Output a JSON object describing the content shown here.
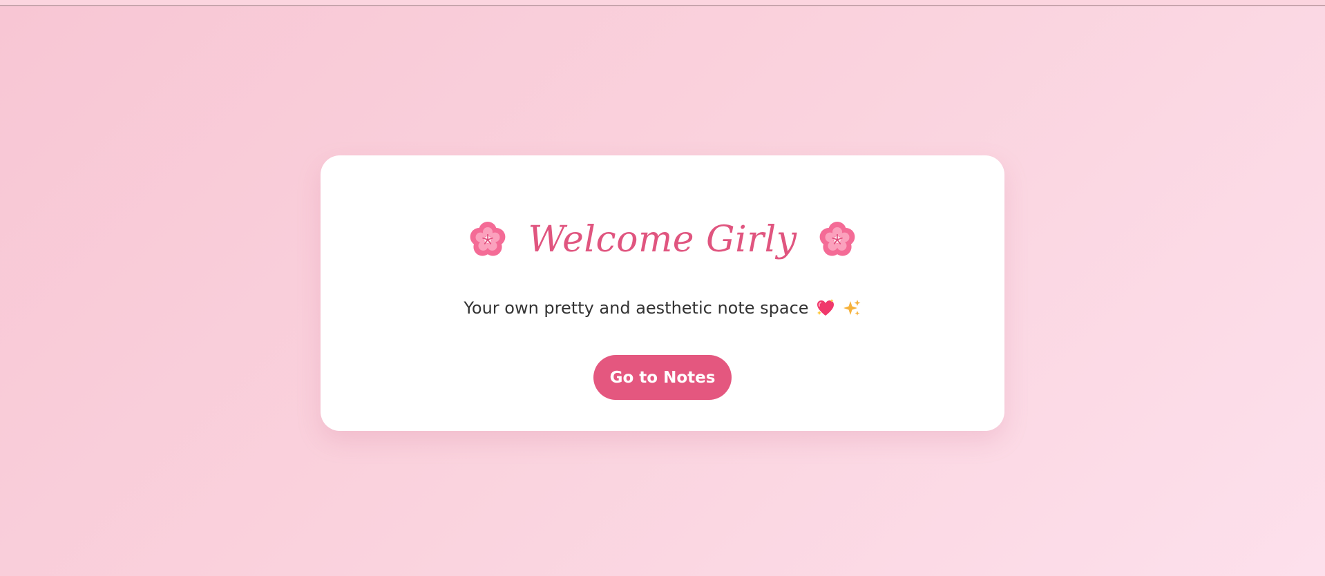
{
  "welcome": {
    "title": "Welcome Girly",
    "subtitle": "Your own pretty and aesthetic note space",
    "button_label": "Go to Notes"
  },
  "icons": {
    "left_decoration": "cherry-blossom-icon",
    "right_decoration": "cherry-blossom-icon",
    "heart": "sparkling-heart-icon",
    "sparkles": "sparkles-icon"
  },
  "colors": {
    "background_start": "#f8c6d4",
    "background_end": "#fde0ec",
    "card": "#ffffff",
    "accent": "#e4577f",
    "title": "#e0557f",
    "text": "#333333"
  }
}
